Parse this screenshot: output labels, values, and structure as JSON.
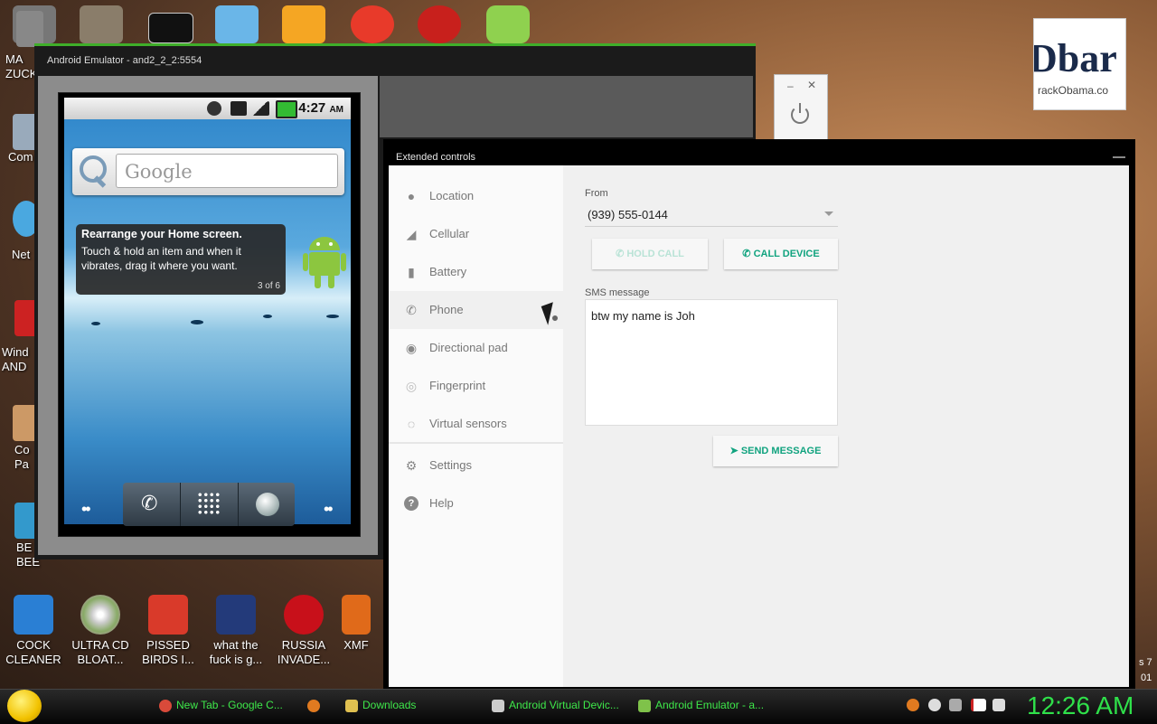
{
  "desktop": {
    "icons": [
      {
        "label": "COCK\nCLEANER",
        "name": "desktop-icon-cock-cleaner"
      },
      {
        "label": "ULTRA CD\nBLOAT...",
        "name": "desktop-icon-ultra-cd"
      },
      {
        "label": "PISSED\nBIRDS I...",
        "name": "desktop-icon-pissed-birds"
      },
      {
        "label": "what the\nfuck is g...",
        "name": "desktop-icon-what-the"
      },
      {
        "label": "RUSSIA\nINVADE...",
        "name": "desktop-icon-russia"
      },
      {
        "label": "XMF",
        "name": "desktop-icon-xmf"
      }
    ],
    "left_edge_labels": [
      "MA\nZUCK",
      "Com",
      "Net",
      "Wind\nAND",
      "Co\nPa",
      "BE\nBEE"
    ],
    "right_edge_text": [
      "s 7",
      "01"
    ]
  },
  "emulator": {
    "title": "Android Emulator - and2_2_2:5554",
    "status_time": "4:27",
    "status_ampm": "AM",
    "search_placeholder": "Google",
    "tip_title": "Rearrange your Home screen.",
    "tip_body": "Touch & hold an item and when it vibrates, drag it where you want.",
    "tip_count": "3 of 6"
  },
  "small_window": {
    "minimize": "–",
    "close": "✕"
  },
  "corner_image": {
    "big": "Dbar",
    "small": "rackObama.co"
  },
  "extended": {
    "title": "Extended controls",
    "nav": [
      {
        "label": "Location",
        "icon": "location-icon"
      },
      {
        "label": "Cellular",
        "icon": "cellular-icon"
      },
      {
        "label": "Battery",
        "icon": "battery-icon"
      },
      {
        "label": "Phone",
        "icon": "phone-icon"
      },
      {
        "label": "Directional pad",
        "icon": "dpad-icon"
      },
      {
        "label": "Fingerprint",
        "icon": "fingerprint-icon"
      },
      {
        "label": "Virtual sensors",
        "icon": "sensors-icon"
      },
      {
        "label": "Settings",
        "icon": "settings-icon"
      },
      {
        "label": "Help",
        "icon": "help-icon"
      }
    ],
    "from_label": "From",
    "from_value": "(939) 555-0144",
    "hold_call": "HOLD CALL",
    "call_device": "CALL DEVICE",
    "sms_label": "SMS message",
    "sms_value": "btw my name is Joh",
    "send_message": "SEND MESSAGE"
  },
  "taskbar": {
    "tasks": [
      {
        "label": "New Tab - Google C...",
        "icon": "chrome-icon",
        "color": "#d94a3a"
      },
      {
        "label": "",
        "icon": "firefox-icon",
        "color": "#e07a20"
      },
      {
        "label": "Downloads",
        "icon": "folder-icon",
        "color": "#e0c050"
      },
      {
        "label": "Android Virtual Devic...",
        "icon": "avd-icon",
        "color": "#cccccc"
      },
      {
        "label": "Android Emulator - a...",
        "icon": "emulator-icon",
        "color": "#7fc24a"
      }
    ],
    "clock": "12:26 AM"
  },
  "colors": {
    "accent": "#11a37f",
    "taskbar_text": "#3ee84a"
  }
}
